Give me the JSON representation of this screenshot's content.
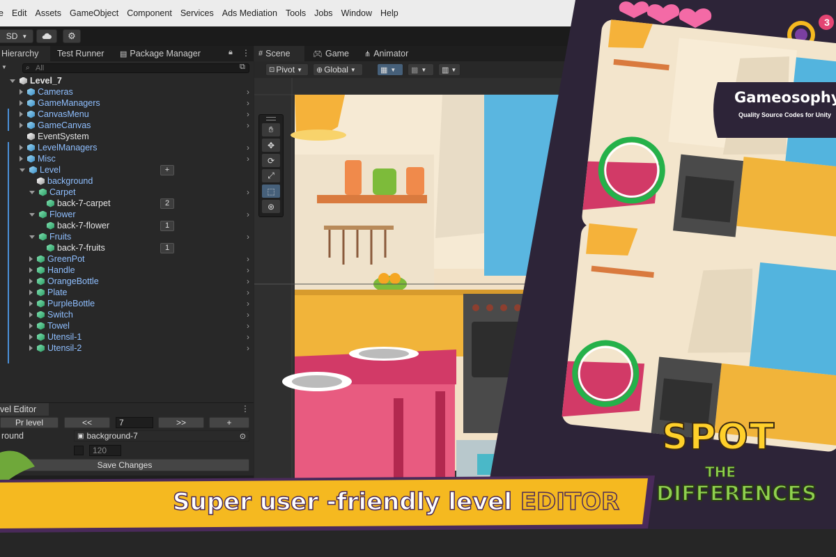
{
  "menu": [
    "e",
    "Edit",
    "Assets",
    "GameObject",
    "Component",
    "Services",
    "Ads Mediation",
    "Tools",
    "Jobs",
    "Window",
    "Help"
  ],
  "toolbar": {
    "sd_label": "SD"
  },
  "hierarchy": {
    "tabs": [
      "Hierarchy",
      "Test Runner",
      "Package Manager"
    ],
    "search_placeholder": "All",
    "root": "Level_7",
    "items": [
      {
        "label": "Cameras",
        "indent": 1,
        "cube": "blue",
        "arrow": "right",
        "chev": true
      },
      {
        "label": "GameManagers",
        "indent": 1,
        "cube": "blue",
        "arrow": "right",
        "chev": true
      },
      {
        "label": "CanvasMenu",
        "indent": 1,
        "cube": "blue",
        "arrow": "right",
        "chev": true
      },
      {
        "label": "GameCanvas",
        "indent": 1,
        "cube": "blue",
        "arrow": "right",
        "chev": true
      },
      {
        "label": "EventSystem",
        "indent": 1,
        "cube": "white",
        "arrow": "none",
        "chev": false,
        "white": true
      },
      {
        "label": "LevelManagers",
        "indent": 1,
        "cube": "blue",
        "arrow": "right",
        "chev": true
      },
      {
        "label": "Misc",
        "indent": 1,
        "cube": "blue",
        "arrow": "right",
        "chev": true
      },
      {
        "label": "Level",
        "indent": 1,
        "cube": "blue",
        "arrow": "down",
        "chev": false,
        "badge": "+"
      },
      {
        "label": "background",
        "indent": 2,
        "cube": "white",
        "arrow": "none",
        "chev": false
      },
      {
        "label": "Carpet",
        "indent": 2,
        "cube": "green",
        "arrow": "down",
        "chev": true
      },
      {
        "label": "back-7-carpet",
        "indent": 3,
        "cube": "green",
        "arrow": "none",
        "chev": false,
        "white": true,
        "badge": "2"
      },
      {
        "label": "Flower",
        "indent": 2,
        "cube": "green",
        "arrow": "down",
        "chev": true
      },
      {
        "label": "back-7-flower",
        "indent": 3,
        "cube": "green",
        "arrow": "none",
        "chev": false,
        "white": true,
        "badge": "1"
      },
      {
        "label": "Fruits",
        "indent": 2,
        "cube": "green",
        "arrow": "down",
        "chev": true
      },
      {
        "label": "back-7-fruits",
        "indent": 3,
        "cube": "green",
        "arrow": "none",
        "chev": false,
        "white": true,
        "badge": "1"
      },
      {
        "label": "GreenPot",
        "indent": 2,
        "cube": "green",
        "arrow": "right",
        "chev": true
      },
      {
        "label": "Handle",
        "indent": 2,
        "cube": "green",
        "arrow": "right",
        "chev": true
      },
      {
        "label": "OrangeBottle",
        "indent": 2,
        "cube": "green",
        "arrow": "right",
        "chev": true
      },
      {
        "label": "Plate",
        "indent": 2,
        "cube": "green",
        "arrow": "right",
        "chev": true
      },
      {
        "label": "PurpleBottle",
        "indent": 2,
        "cube": "green",
        "arrow": "right",
        "chev": true
      },
      {
        "label": "Switch",
        "indent": 2,
        "cube": "green",
        "arrow": "right",
        "chev": true
      },
      {
        "label": "Towel",
        "indent": 2,
        "cube": "green",
        "arrow": "right",
        "chev": true
      },
      {
        "label": "Utensil-1",
        "indent": 2,
        "cube": "green",
        "arrow": "right",
        "chev": true
      },
      {
        "label": "Utensil-2",
        "indent": 2,
        "cube": "green",
        "arrow": "right",
        "chev": true
      }
    ]
  },
  "level_editor": {
    "tab": "vel Editor",
    "prev_level": "Pr  level",
    "back": "<<",
    "level_value": "7",
    "forward": ">>",
    "plus": "+",
    "background_label": "round",
    "background_value": "background-7",
    "number_value": "120",
    "save": "Save Changes"
  },
  "scene": {
    "tabs": [
      "Scene",
      "Game",
      "Animator"
    ],
    "pivot": "Pivot",
    "global": "Global"
  },
  "promo": {
    "brand_title": "Gameosophy",
    "brand_subtitle": "Quality Source Codes for Unity",
    "badge_count": "3",
    "logo_line1": "SPOT",
    "logo_line2": "THE",
    "logo_line3": "DIFFERENCES",
    "banner_text_1": "Super user -friendly level ",
    "banner_text_2": "EDITOR"
  },
  "colors": {
    "accent_yellow": "#f5b920",
    "banner_purple": "#4a2a5a",
    "logo_green": "#8fd14f",
    "logo_yellow": "#ffd02a",
    "highlight_green": "#25b14a"
  }
}
